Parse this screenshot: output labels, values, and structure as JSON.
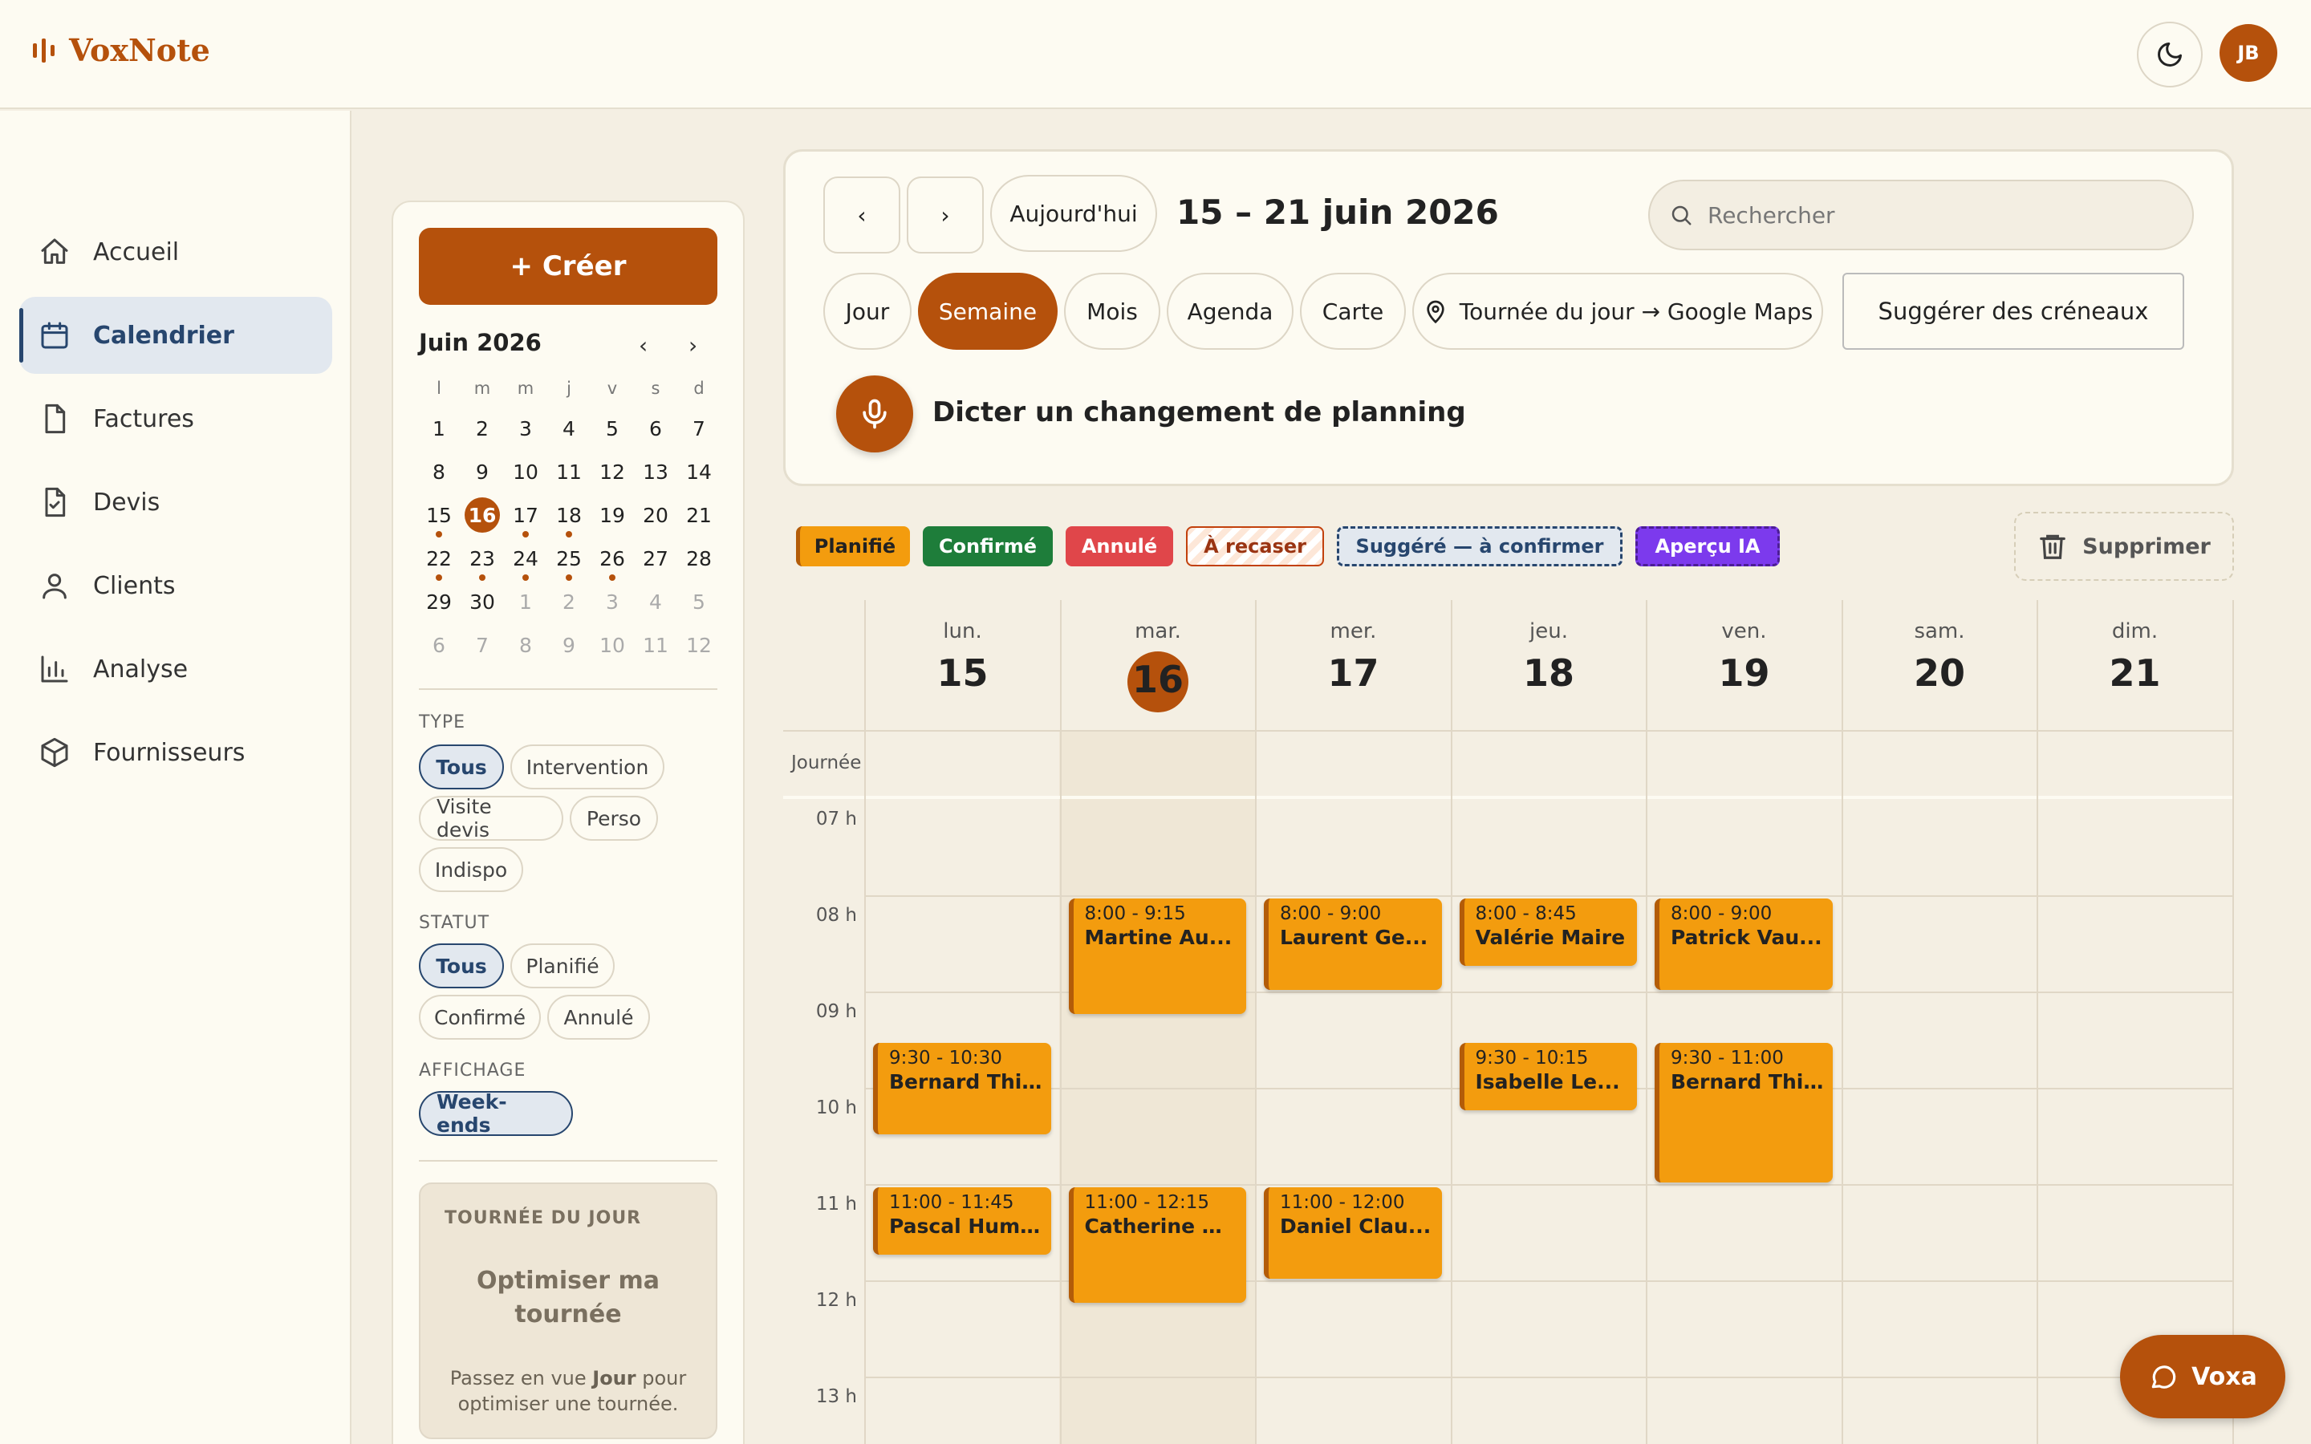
{
  "app": {
    "name": "VoxNote",
    "user_initials": "JB"
  },
  "colors": {
    "accent": "#b5510c",
    "nav_active": "#27466e",
    "event": "#f39c0e"
  },
  "nav": {
    "items": [
      {
        "label": "Accueil",
        "icon": "home-icon"
      },
      {
        "label": "Calendrier",
        "icon": "calendar-icon",
        "active": true
      },
      {
        "label": "Factures",
        "icon": "file-icon"
      },
      {
        "label": "Devis",
        "icon": "file-check-icon"
      },
      {
        "label": "Clients",
        "icon": "user-icon"
      },
      {
        "label": "Analyse",
        "icon": "bar-chart-icon"
      },
      {
        "label": "Fournisseurs",
        "icon": "package-icon"
      }
    ]
  },
  "panel": {
    "create_label": "+ Créer",
    "mini": {
      "title": "Juin 2026",
      "prev": "‹",
      "next": "›",
      "dow": [
        "l",
        "m",
        "m",
        "j",
        "v",
        "s",
        "d"
      ],
      "weeks": [
        [
          "1",
          "2",
          "3",
          "4",
          "5",
          "6",
          "7"
        ],
        [
          "8",
          "9",
          "10",
          "11",
          "12",
          "13",
          "14"
        ],
        [
          "15",
          "16",
          "17",
          "18",
          "19",
          "20",
          "21"
        ],
        [
          "22",
          "23",
          "24",
          "25",
          "26",
          "27",
          "28"
        ],
        [
          "29",
          "30",
          "1",
          "2",
          "3",
          "4",
          "5"
        ],
        [
          "6",
          "7",
          "8",
          "9",
          "10",
          "11",
          "12"
        ]
      ],
      "today": "16"
    },
    "type_label": "TYPE",
    "type_chips": [
      "Tous",
      "Intervention",
      "Visite devis",
      "Perso",
      "Indispo"
    ],
    "status_label": "STATUT",
    "status_chips": [
      "Tous",
      "Planifié",
      "Confirmé",
      "Annulé"
    ],
    "display_label": "AFFICHAGE",
    "display_chips": [
      "Week-ends"
    ],
    "tour": {
      "heading": "TOURNÉE DU JOUR",
      "title_line1": "Optimiser ma",
      "title_line2": "tournée",
      "hint_pre": "Passez en vue ",
      "hint_bold": "Jour",
      "hint_post": " pour",
      "hint_line2": "optimiser une tournée."
    }
  },
  "toolbar": {
    "prev": "‹",
    "next": "›",
    "today": "Aujourd'hui",
    "range": "15 – 21 juin 2026",
    "search_placeholder": "Rechercher",
    "views": [
      "Jour",
      "Semaine",
      "Mois",
      "Agenda",
      "Carte"
    ],
    "active_view": "Semaine",
    "route_label": "Tournée du jour → Google Maps",
    "suggest_label": "Suggérer des créneaux",
    "dictate_label": "Dicter un changement de planning"
  },
  "legend": [
    {
      "label": "Planifié",
      "bg": "#f39c0e",
      "color": "#222"
    },
    {
      "label": "Confirmé",
      "bg": "#1e7d3a",
      "color": "#fff"
    },
    {
      "label": "Annulé",
      "bg": "#e0464a",
      "color": "#fff"
    },
    {
      "label": "À recaser",
      "bg": "stripes",
      "color": "#9a3412"
    },
    {
      "label": "Suggéré — à confirmer",
      "bg": "#e2e8ef",
      "color": "#27466e"
    },
    {
      "label": "Aperçu IA",
      "bg": "#7c3aed",
      "color": "#fff"
    }
  ],
  "delete_label": "Supprimer",
  "week": {
    "days": [
      {
        "name": "lun.",
        "num": "15"
      },
      {
        "name": "mar.",
        "num": "16",
        "today": true
      },
      {
        "name": "mer.",
        "num": "17"
      },
      {
        "name": "jeu.",
        "num": "18"
      },
      {
        "name": "ven.",
        "num": "19"
      },
      {
        "name": "sam.",
        "num": "20"
      },
      {
        "name": "dim.",
        "num": "21"
      }
    ],
    "allday_label": "Journée",
    "hours": [
      "07 h",
      "08 h",
      "09 h",
      "10 h",
      "11 h",
      "12 h",
      "13 h"
    ],
    "events": [
      {
        "day": 1,
        "start": "8:00",
        "end": "9:15",
        "time": "8:00 - 9:15",
        "name": "Martine Au..."
      },
      {
        "day": 2,
        "start": "8:00",
        "end": "9:00",
        "time": "8:00 - 9:00",
        "name": "Laurent Ge..."
      },
      {
        "day": 3,
        "start": "8:00",
        "end": "8:45",
        "time": "8:00 - 8:45",
        "name": "Valérie Maire"
      },
      {
        "day": 4,
        "start": "8:00",
        "end": "9:00",
        "time": "8:00 - 9:00",
        "name": "Patrick Vau..."
      },
      {
        "day": 0,
        "start": "9:30",
        "end": "10:30",
        "time": "9:30 - 10:30",
        "name": "Bernard Thi..."
      },
      {
        "day": 3,
        "start": "9:30",
        "end": "10:15",
        "time": "9:30 - 10:15",
        "name": "Isabelle Le..."
      },
      {
        "day": 4,
        "start": "9:30",
        "end": "11:00",
        "time": "9:30 - 11:00",
        "name": "Bernard Thi..."
      },
      {
        "day": 0,
        "start": "11:00",
        "end": "11:45",
        "time": "11:00 - 11:45",
        "name": "Pascal Hum..."
      },
      {
        "day": 1,
        "start": "11:00",
        "end": "12:15",
        "time": "11:00 - 12:15",
        "name": "Catherine D..."
      },
      {
        "day": 2,
        "start": "11:00",
        "end": "12:00",
        "time": "11:00 - 12:00",
        "name": "Daniel Clau..."
      }
    ]
  },
  "assistant_label": "Voxa"
}
